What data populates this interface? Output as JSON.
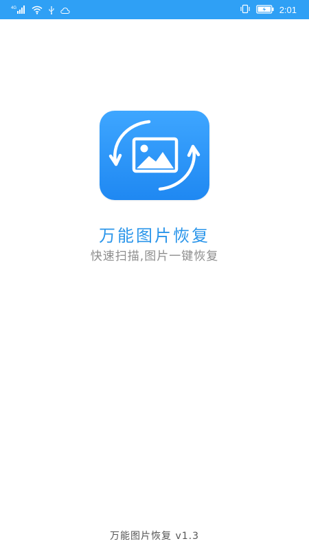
{
  "status_bar": {
    "network_type": "4G",
    "time": "2:01",
    "background_color": "#2fa0f5",
    "icons": [
      "signal-icon",
      "wifi-icon",
      "usb-icon",
      "cloud-icon",
      "vibrate-icon",
      "battery-icon"
    ]
  },
  "splash": {
    "icon": "image-restore-icon",
    "icon_color": "#2a8ff0",
    "app_name": "万能图片恢复",
    "slogan": "快速扫描,图片一键恢复",
    "name_color": "#2a95ea",
    "slogan_color": "#8d8d8d"
  },
  "footer": {
    "version_text": "万能图片恢复 v1.3"
  }
}
